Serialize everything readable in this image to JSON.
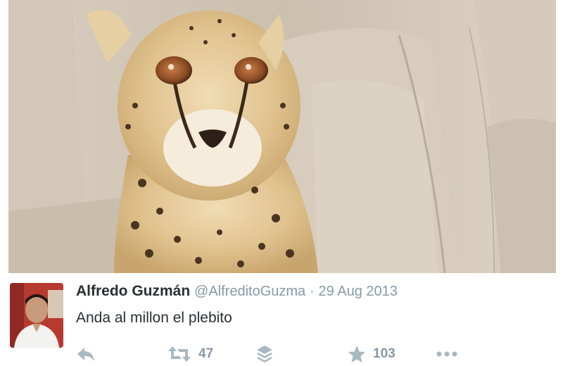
{
  "tweet": {
    "author_name": "Alfredo Guzmán",
    "handle": "@AlfreditoGuzma",
    "separator": "·",
    "date": "29 Aug 2013",
    "text": "Anda al millon el plebito",
    "retweet_count": "47",
    "favorite_count": "103"
  },
  "icons": {
    "reply": "reply-icon",
    "retweet": "retweet-icon",
    "buffer": "layers-icon",
    "favorite": "star-icon",
    "more": "more-icon"
  },
  "colors": {
    "name": "#292f33",
    "meta": "#8899a6",
    "icon": "#aab8c2"
  }
}
